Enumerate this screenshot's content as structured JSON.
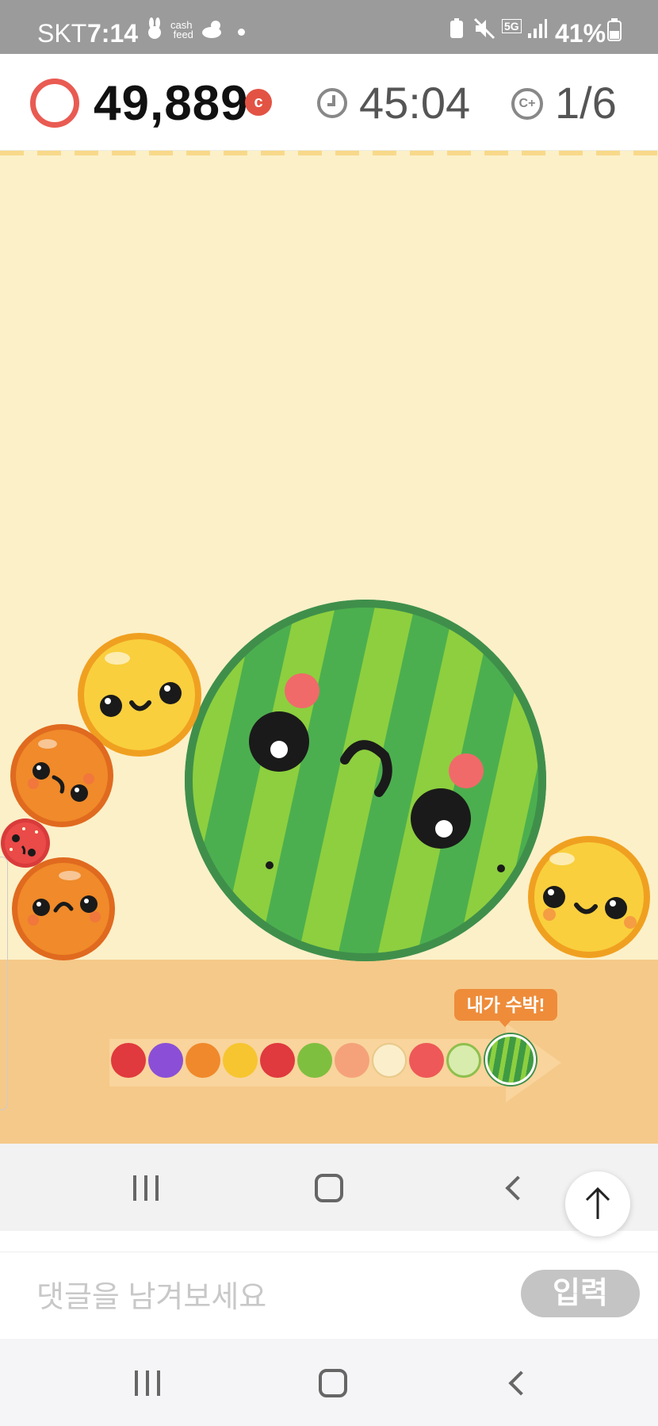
{
  "status_bar": {
    "carrier": "SKT",
    "time": "7:14",
    "battery": "41%",
    "network": "5G"
  },
  "header": {
    "score": "49,889",
    "coin_symbol": "c",
    "timer": "45:04",
    "bonus_symbol": "C+",
    "attempts": "1/6"
  },
  "game": {
    "evolution_tooltip": "내가 수박!",
    "fruit_chain": [
      "cherry",
      "grape",
      "orange",
      "persimmon",
      "apple",
      "kiwi",
      "peach",
      "pear",
      "strawberry",
      "melon",
      "watermelon"
    ]
  },
  "comment": {
    "placeholder": "댓글을 남겨보세요",
    "submit_label": "입력"
  },
  "colors": {
    "game_bg": "#fcf0c8",
    "floor": "#f5c989",
    "accent_red": "#e95b52",
    "tooltip": "#ee8c3a"
  }
}
